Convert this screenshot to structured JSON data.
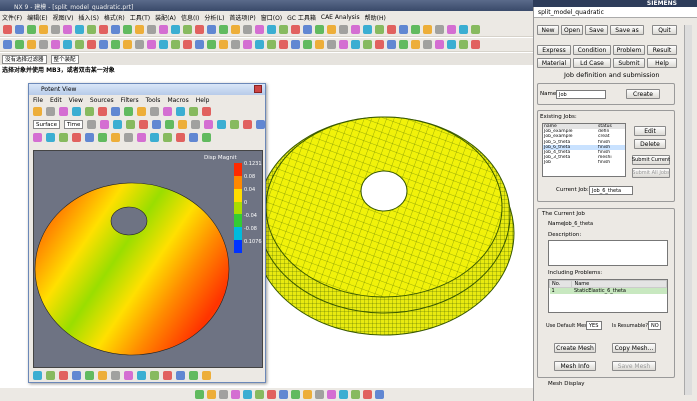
{
  "app": {
    "title": "NX 9 - 建模 - [split_model_quadratic.prt]"
  },
  "menubar": [
    "文件(F)",
    "编辑(E)",
    "视图(V)",
    "插入(S)",
    "格式(R)",
    "工具(T)",
    "装配(A)",
    "信息(I)",
    "分析(L)",
    "首选项(P)",
    "窗口(O)",
    "GC 工具箱",
    "CAE Analysis",
    "帮助(H)"
  ],
  "filter": {
    "type_filter": "没有选择过滤器",
    "scope": "整个装配"
  },
  "prompt": "选择对象并使用 MB3，或者双击某一对象",
  "potent": {
    "title": "Potent View",
    "menu": [
      "File",
      "Edit",
      "View",
      "Sources",
      "Filters",
      "Tools",
      "Macros",
      "Help"
    ],
    "source_select": "Surface",
    "time_label": "Time",
    "legend_title": "Disp Magnit",
    "legend_values": [
      "0.12313",
      "0.08",
      "0.04",
      "0",
      "-0.04",
      "-0.08",
      "0.107685"
    ],
    "legend_colors": [
      "#ff2a00",
      "#ff8800",
      "#ffdd00",
      "#aadd00",
      "#33cc33",
      "#00bbdd",
      "#0033ff"
    ]
  },
  "panel": {
    "title": "split_model_quadratic",
    "brand": "SIEMENS",
    "row1": [
      "New",
      "Open",
      "Save",
      "Save as",
      "Quit"
    ],
    "row2": [
      "Express",
      "Condition",
      "Problem",
      "Result"
    ],
    "row3": [
      "Material",
      "Ld Case",
      "Submit",
      "Help"
    ],
    "section_title": "Job definition and submission",
    "name_label": "Name:",
    "name_value": "Job",
    "create": "Create",
    "existing_jobs": "Existing Jobs:",
    "jobs_headers": [
      "name",
      "status"
    ],
    "jobs": [
      [
        "Job_example",
        "defin"
      ],
      [
        "Job_example",
        "creat"
      ],
      [
        "Job_5_theta",
        "finish"
      ],
      [
        "Job_6_theta",
        "finish"
      ],
      [
        "Job_4_theta",
        "finish"
      ],
      [
        "Job_3_theta",
        "meshi"
      ],
      [
        "Job",
        "finish"
      ]
    ],
    "edit": "Edit",
    "delete": "Delete",
    "submit_current": "Submit Current",
    "submit_all": "Submit All Jobs",
    "current_job_label": "Current Job:",
    "current_job_value": "Job_6_theta",
    "the_current_job": "The Current Job",
    "cj_name_label": "Name:",
    "cj_name_value": "Job_6_theta",
    "description": "Description:",
    "including": "Including Problems:",
    "prob_headers": [
      "No.",
      "Name"
    ],
    "prob_rows": [
      [
        "1",
        "StaticElastic_6_theta"
      ]
    ],
    "default_mesh_label": "Use Default Mesh?",
    "default_mesh_value": "YES",
    "resumable_label": "Is Resumable?",
    "resumable_value": "NO",
    "create_mesh": "Create Mesh",
    "copy_mesh": "Copy Mesh...",
    "mesh_info": "Mesh Info",
    "save_mesh": "Save Mesh",
    "mesh_display": "Mesh Display"
  }
}
